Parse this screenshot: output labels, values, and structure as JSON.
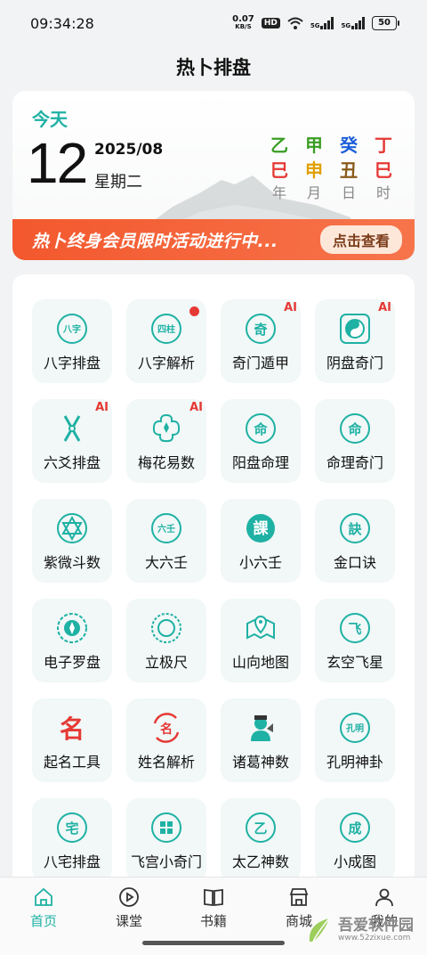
{
  "status": {
    "time": "09:34:28",
    "speed_value": "0.07",
    "speed_unit": "KB/S",
    "hd": "HD",
    "sig1": "5G",
    "sig2": "5G",
    "battery": "50"
  },
  "header": {
    "title": "热卜排盘"
  },
  "date": {
    "today": "今天",
    "day": "12",
    "year_month": "2025/08",
    "weekday": "星期二",
    "ganzhi": [
      {
        "stem": "乙",
        "branch": "巳",
        "label": "年",
        "stem_color": "#3a9d23",
        "branch_color": "#e53935"
      },
      {
        "stem": "甲",
        "branch": "申",
        "label": "月",
        "stem_color": "#3a9d23",
        "branch_color": "#e0a000"
      },
      {
        "stem": "癸",
        "branch": "丑",
        "label": "日",
        "stem_color": "#1e5fd8",
        "branch_color": "#8a5a1a"
      },
      {
        "stem": "丁",
        "branch": "巳",
        "label": "时",
        "stem_color": "#e53935",
        "branch_color": "#e53935"
      }
    ]
  },
  "promo": {
    "text": "热卜终身会员限时活动进行中...",
    "button": "点击查看"
  },
  "tools": [
    {
      "label": "八字排盘",
      "icon": "bazi-icon",
      "glyph": "八字",
      "badge": ""
    },
    {
      "label": "八字解析",
      "icon": "sizhu-icon",
      "glyph": "四柱",
      "badge": "dot"
    },
    {
      "label": "奇门遁甲",
      "icon": "qimen-icon",
      "glyph": "奇",
      "badge": "AI"
    },
    {
      "label": "阴盘奇门",
      "icon": "yinyang-icon",
      "glyph": "",
      "badge": "AI"
    },
    {
      "label": "六爻排盘",
      "icon": "liuyao-icon",
      "glyph": "",
      "badge": "AI"
    },
    {
      "label": "梅花易数",
      "icon": "plum-blossom-icon",
      "glyph": "",
      "badge": "AI"
    },
    {
      "label": "阳盘命理",
      "icon": "yangpan-icon",
      "glyph": "命",
      "badge": ""
    },
    {
      "label": "命理奇门",
      "icon": "mingli-icon",
      "glyph": "命",
      "badge": ""
    },
    {
      "label": "紫微斗数",
      "icon": "ziwei-star-icon",
      "glyph": "",
      "badge": ""
    },
    {
      "label": "大六壬",
      "icon": "daliuren-icon",
      "glyph": "六壬",
      "badge": ""
    },
    {
      "label": "小六壬",
      "icon": "xiaoliuren-icon",
      "glyph": "課",
      "badge": ""
    },
    {
      "label": "金口诀",
      "icon": "jinkoujue-icon",
      "glyph": "訣",
      "badge": ""
    },
    {
      "label": "电子罗盘",
      "icon": "compass-icon",
      "glyph": "",
      "badge": ""
    },
    {
      "label": "立极尺",
      "icon": "liji-ruler-icon",
      "glyph": "",
      "badge": ""
    },
    {
      "label": "山向地图",
      "icon": "map-pin-icon",
      "glyph": "",
      "badge": ""
    },
    {
      "label": "玄空飞星",
      "icon": "xuankong-icon",
      "glyph": "飞",
      "badge": ""
    },
    {
      "label": "起名工具",
      "icon": "naming-icon",
      "glyph": "名",
      "badge": ""
    },
    {
      "label": "姓名解析",
      "icon": "name-analysis-icon",
      "glyph": "名",
      "badge": ""
    },
    {
      "label": "诸葛神数",
      "icon": "zhuge-icon",
      "glyph": "",
      "badge": ""
    },
    {
      "label": "孔明神卦",
      "icon": "kongming-icon",
      "glyph": "孔明",
      "badge": ""
    },
    {
      "label": "八宅排盘",
      "icon": "bazhai-icon",
      "glyph": "宅",
      "badge": ""
    },
    {
      "label": "飞宫小奇门",
      "icon": "feigong-icon",
      "glyph": "",
      "badge": ""
    },
    {
      "label": "太乙神数",
      "icon": "taiyi-icon",
      "glyph": "乙",
      "badge": ""
    },
    {
      "label": "小成图",
      "icon": "xiaocheng-icon",
      "glyph": "成",
      "badge": ""
    }
  ],
  "nav": [
    {
      "label": "首页",
      "icon": "home-icon",
      "active": true
    },
    {
      "label": "课堂",
      "icon": "play-icon",
      "active": false
    },
    {
      "label": "书籍",
      "icon": "book-icon",
      "active": false
    },
    {
      "label": "商城",
      "icon": "store-icon",
      "active": false
    },
    {
      "label": "我的",
      "icon": "user-icon",
      "active": false
    }
  ],
  "watermark": {
    "text": "吾爱软件园",
    "url": "www.52zixue.com"
  },
  "colors": {
    "accent": "#1fb1a4",
    "promo": "#f3582e",
    "badge": "#e53935"
  }
}
